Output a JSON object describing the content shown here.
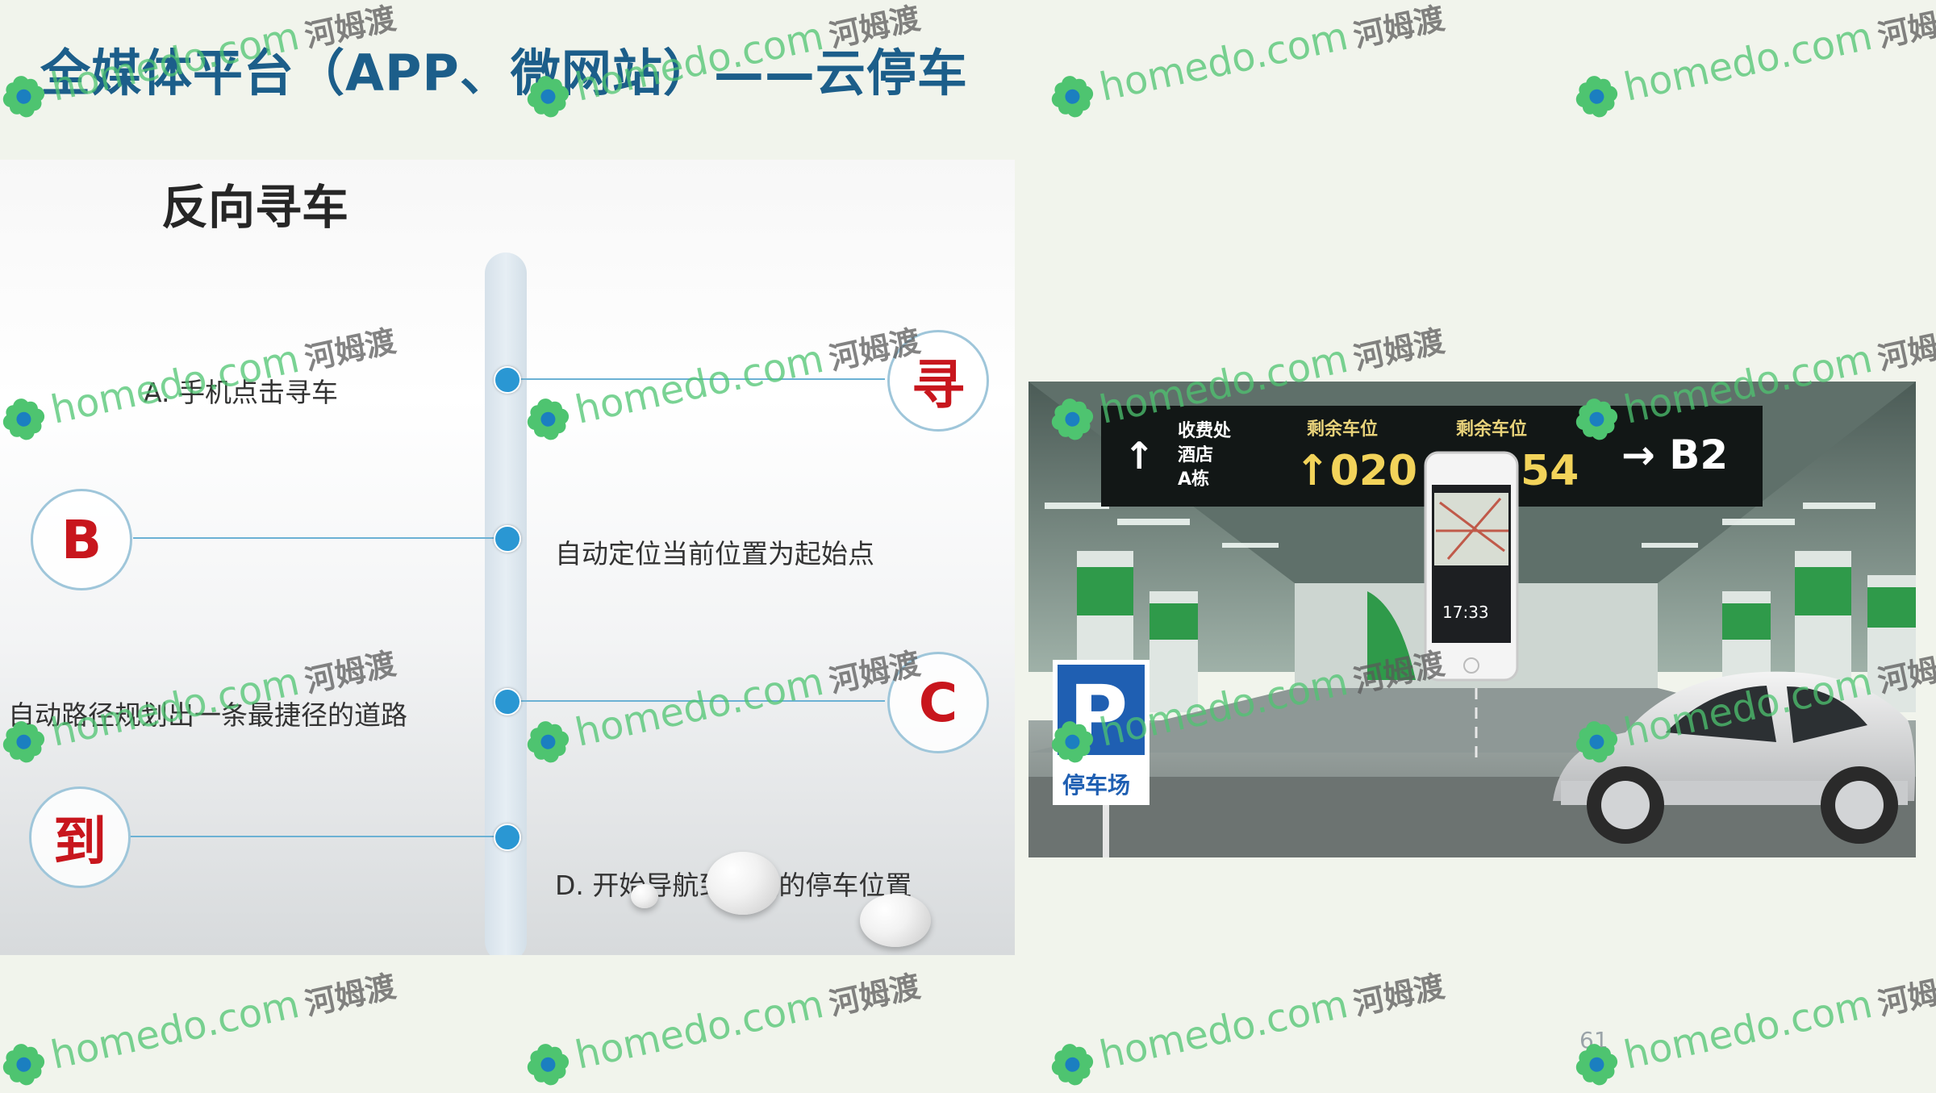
{
  "slide": {
    "title": "全媒体平台（APP、微网站）——云停车",
    "page_number": "61"
  },
  "timeline": {
    "heading": "反向寻车",
    "circles": {
      "find": "寻",
      "b": "B",
      "c": "C",
      "arrive": "到"
    },
    "steps": {
      "a": "A. 手机点击寻车",
      "b": "自动定位当前位置为起始点",
      "c": "自动路径规划出一条最捷径的道路",
      "d": "D.  开始导航到进入的停车位置"
    }
  },
  "photo": {
    "signboard": {
      "left_lines": [
        "收费处",
        "酒店",
        "A栋"
      ],
      "remaining_label_1": "剩余车位",
      "remaining_value_1": "↑020",
      "remaining_label_2": "剩余车位",
      "remaining_value_2": "54",
      "exit": "→ B2"
    },
    "phone_time": "17:33",
    "parking_sign_letter": "P",
    "parking_sign_text": "停车场"
  },
  "watermark": {
    "brand": "homedo.com",
    "cn": "河姆渡"
  },
  "colors": {
    "title": "#1c5e8a",
    "accent_red": "#c8161d",
    "dot_blue": "#2a97d3",
    "watermark_green": "#4ec470"
  }
}
